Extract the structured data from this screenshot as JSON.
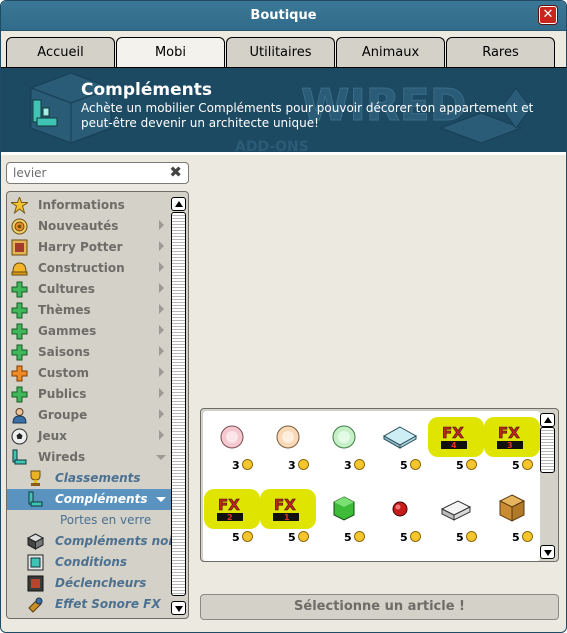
{
  "window": {
    "title": "Boutique"
  },
  "tabs": [
    {
      "label": "Accueil"
    },
    {
      "label": "Mobi"
    },
    {
      "label": "Utilitaires"
    },
    {
      "label": "Animaux"
    },
    {
      "label": "Rares"
    }
  ],
  "active_tab": "Mobi",
  "header": {
    "title": "Compléments",
    "description": "Achète un mobilier Compléments pour pouvoir décorer ton appartement et peut-être devenir un architecte unique!",
    "background_text_1": "WIRED",
    "background_text_2": "ADD-ONS"
  },
  "search": {
    "value": "levier"
  },
  "categories": [
    {
      "label": "Informations",
      "icon": "star-burst-icon",
      "arrow": "none"
    },
    {
      "label": "Nouveautés",
      "icon": "target-icon",
      "arrow": "right"
    },
    {
      "label": "Harry Potter",
      "icon": "portrait-icon",
      "arrow": "right"
    },
    {
      "label": "Construction",
      "icon": "hard-hat-icon",
      "arrow": "right"
    },
    {
      "label": "Cultures",
      "icon": "green-plus-icon",
      "arrow": "right"
    },
    {
      "label": "Thèmes",
      "icon": "green-plus-icon",
      "arrow": "right"
    },
    {
      "label": "Gammes",
      "icon": "green-plus-icon",
      "arrow": "right"
    },
    {
      "label": "Saisons",
      "icon": "green-plus-icon",
      "arrow": "right"
    },
    {
      "label": "Custom",
      "icon": "orange-plus-icon",
      "arrow": "right"
    },
    {
      "label": "Publics",
      "icon": "green-plus-icon",
      "arrow": "right"
    },
    {
      "label": "Groupe",
      "icon": "group-icon",
      "arrow": "right"
    },
    {
      "label": "Jeux",
      "icon": "ball-icon",
      "arrow": "right"
    },
    {
      "label": "Wireds",
      "icon": "wired-icon",
      "arrow": "down"
    }
  ],
  "subcategories": [
    {
      "label": "Classements",
      "icon": "trophy-icon",
      "selected": false
    },
    {
      "label": "Compléments",
      "icon": "wired-addon-icon",
      "selected": true
    }
  ],
  "subsubcategories": [
    {
      "label": "Portes en verre"
    }
  ],
  "subcategories_more": [
    {
      "label": "Compléments noir & blanc",
      "icon": "cube-icon"
    },
    {
      "label": "Conditions",
      "icon": "condition-icon"
    },
    {
      "label": "Déclencheurs",
      "icon": "trigger-icon"
    },
    {
      "label": "Effet Sonore FX",
      "icon": "sound-icon"
    }
  ],
  "items": [
    {
      "icon": "pink-orb-icon",
      "price": "3",
      "highlight": false
    },
    {
      "icon": "peach-orb-icon",
      "price": "3",
      "highlight": false
    },
    {
      "icon": "green-orb-icon",
      "price": "3",
      "highlight": false
    },
    {
      "icon": "glass-tile-icon",
      "price": "5",
      "highlight": false
    },
    {
      "icon": "fx-4-icon",
      "price": "5",
      "highlight": true,
      "fx_number": "4"
    },
    {
      "icon": "fx-3-icon",
      "price": "5",
      "highlight": true,
      "fx_number": "3"
    },
    {
      "icon": "fx-2-icon",
      "price": "5",
      "highlight": true,
      "fx_number": "2"
    },
    {
      "icon": "fx-1-icon",
      "price": "5",
      "highlight": true,
      "fx_number": "1"
    },
    {
      "icon": "green-cube-icon",
      "price": "5",
      "highlight": false
    },
    {
      "icon": "red-button-icon",
      "price": "5",
      "highlight": false
    },
    {
      "icon": "white-block-icon",
      "price": "5",
      "highlight": false
    },
    {
      "icon": "wooden-crate-icon",
      "price": "5",
      "highlight": false
    }
  ],
  "status": {
    "label": "Sélectionne un article !"
  },
  "colors": {
    "titlebar": "#3a7796",
    "banner": "#1d4a63",
    "selected_row": "#5a93c0",
    "highlight": "#dfe400"
  }
}
